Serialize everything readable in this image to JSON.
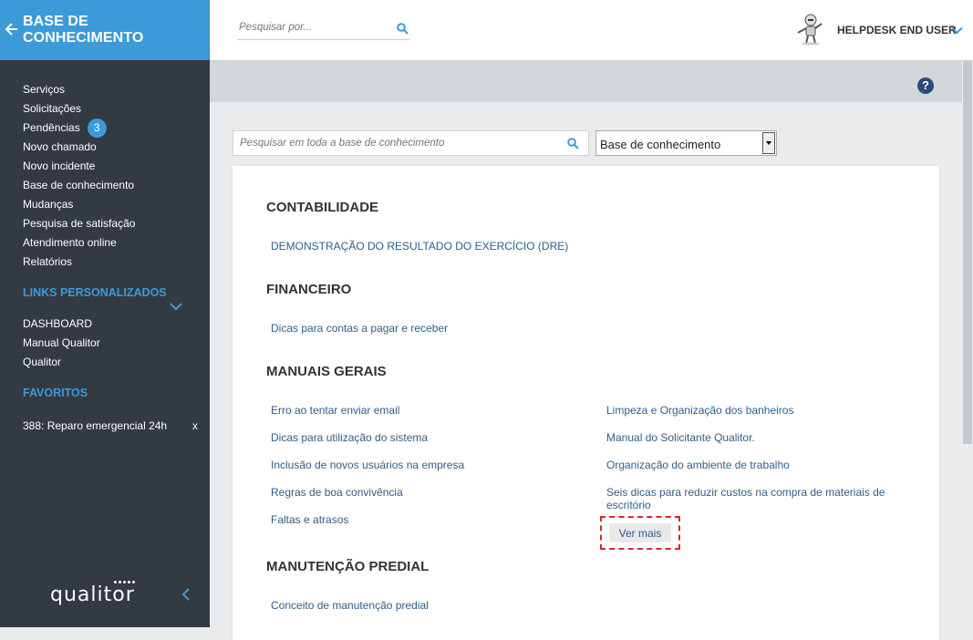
{
  "sidebar": {
    "header_title": "BASE DE CONHECIMENTO",
    "menu": [
      {
        "label": "Serviços"
      },
      {
        "label": "Solicitações"
      },
      {
        "label": "Pendências",
        "badge": "3"
      },
      {
        "label": "Novo chamado"
      },
      {
        "label": "Novo incidente"
      },
      {
        "label": "Base de conhecimento"
      },
      {
        "label": "Mudanças"
      },
      {
        "label": "Pesquisa de satisfação"
      },
      {
        "label": "Atendimento online"
      },
      {
        "label": "Relatórios"
      }
    ],
    "links_title": "LINKS PERSONALIZADOS",
    "links": [
      {
        "label": "DASHBOARD"
      },
      {
        "label": "Manual Qualitor"
      },
      {
        "label": "Qualitor"
      }
    ],
    "favorites_title": "FAVORITOS",
    "favorites": [
      {
        "label": "388: Reparo emergencial 24h",
        "remove": "x"
      }
    ],
    "logo_text": "qualitor"
  },
  "topbar": {
    "search_placeholder": "Pesquisar por...",
    "username": "HELPDESK END USER"
  },
  "help_label": "?",
  "kb": {
    "search_placeholder": "Pesquisar em toda a base de conhecimento",
    "select_value": "Base de conhecimento",
    "categories": [
      {
        "title": "CONTABILIDADE",
        "articles": [
          "DEMONSTRAÇÃO DO RESULTADO DO EXERCÍCIO (DRE)"
        ]
      },
      {
        "title": "FINANCEIRO",
        "articles": [
          "Dicas para contas a pagar e receber"
        ]
      },
      {
        "title": "MANUAIS GERAIS",
        "articles": [
          "Erro ao tentar enviar email",
          "Dicas para utilização do sistema",
          "Inclusão de novos usuários na empresa",
          "Regras de boa convivência",
          "Faltas e atrasos",
          "Limpeza e Organização dos banheiros",
          "Manual do Solicitante Qualitor.",
          "Organização do ambiente de trabalho",
          "Seis dicas para reduzir custos na compra de materiais de escritório"
        ],
        "more_label": "Ver mais"
      },
      {
        "title": "MANUTENÇÃO PREDIAL",
        "articles": [
          "Conceito de manutenção predial"
        ]
      }
    ]
  },
  "colors": {
    "accent": "#3d9ad9",
    "sidebar_bg": "#343a42",
    "link": "#2f5d8a",
    "highlight": "#d9262c"
  }
}
